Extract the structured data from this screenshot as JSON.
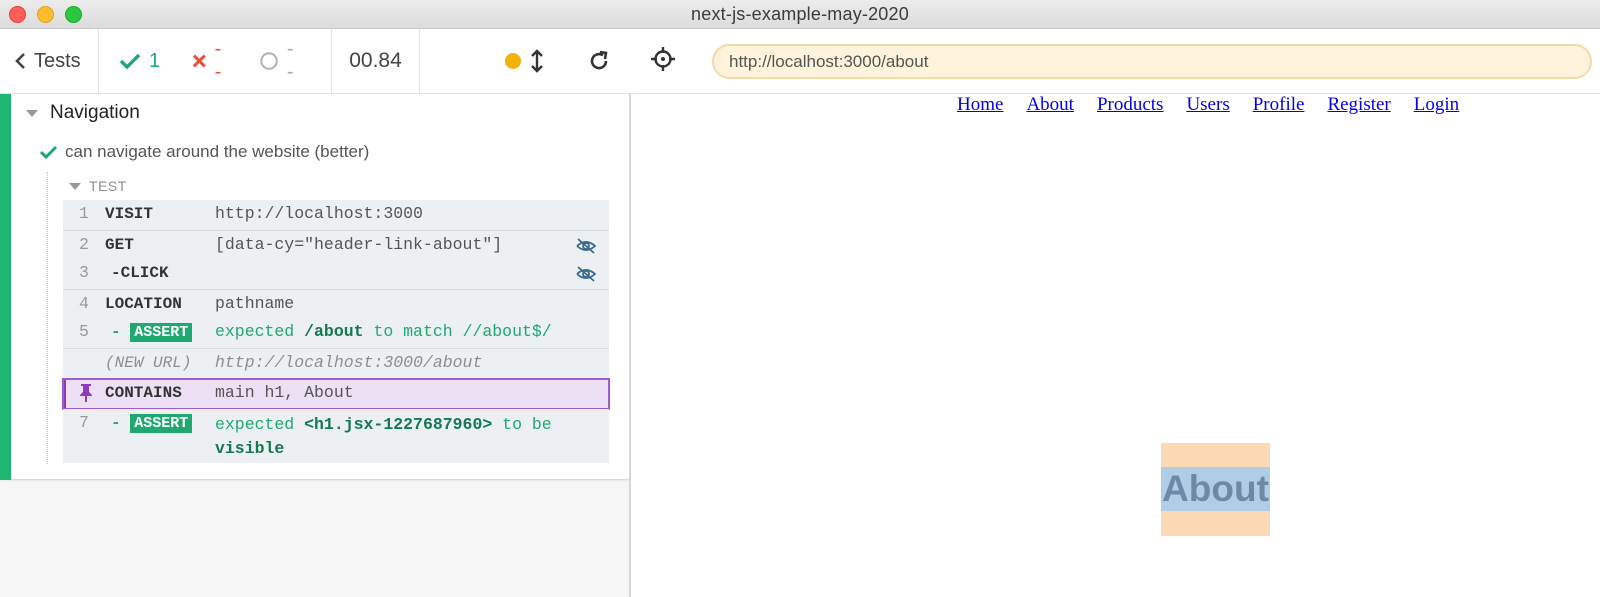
{
  "window": {
    "title": "next-js-example-may-2020"
  },
  "reporter": {
    "tests_label": "Tests",
    "passed": "1",
    "failed": "--",
    "pending": "--",
    "duration": "00.84",
    "suite_title": "Navigation",
    "test_title": "can navigate around the website (better)",
    "section_label": "TEST",
    "commands": [
      {
        "num": "1",
        "name": "VISIT",
        "message": "http://localhost:3000"
      },
      {
        "num": "2",
        "name": "GET",
        "message": "[data-cy=\"header-link-about\"]"
      },
      {
        "num": "3",
        "name": "-CLICK",
        "message": ""
      },
      {
        "num": "4",
        "name": "LOCATION",
        "message": "pathname"
      },
      {
        "num": "5",
        "prefix": "-",
        "name": "ASSERT",
        "msg_a": "expected",
        "msg_b": "/about",
        "msg_c": "to match //about$/"
      },
      {
        "num": "",
        "name": "(NEW URL)",
        "message": "http://localhost:3000/about"
      },
      {
        "num": "",
        "name": "CONTAINS",
        "message": "main h1, About"
      },
      {
        "num": "7",
        "prefix": "-",
        "name": "ASSERT",
        "msg_a": "expected",
        "msg_b": "<h1.jsx-1227687960>",
        "msg_c": "to be",
        "msg_d": "visible"
      }
    ]
  },
  "aut": {
    "url": "http://localhost:3000/about",
    "nav_links": [
      "Home",
      "About",
      "Products",
      "Users",
      "Profile",
      "Register",
      "Login"
    ],
    "heading": "About"
  },
  "colors": {
    "pass": "#1fa971",
    "fail": "#e94f37",
    "accent_purple": "#8e3bbf",
    "url_bg": "#fff3dc"
  }
}
